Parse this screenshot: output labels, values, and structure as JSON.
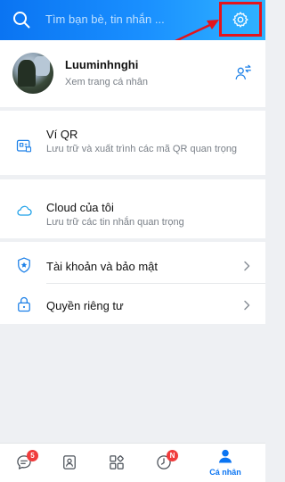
{
  "header": {
    "search_placeholder": "Tìm bạn bè, tin nhắn ..."
  },
  "profile": {
    "name": "Luuminhnghi",
    "subtitle": "Xem trang cá nhân"
  },
  "qr_wallet": {
    "title": "Ví QR",
    "description": "Lưu trữ và xuất trình các mã QR quan trọng"
  },
  "cloud": {
    "title": "Cloud của tôi",
    "description": "Lưu trữ các tin nhắn quan trọng"
  },
  "menu": [
    {
      "label": "Tài khoản và bảo mật",
      "icon": "shield-icon"
    },
    {
      "label": "Quyền riêng tư",
      "icon": "lock-icon"
    }
  ],
  "bottom_nav": {
    "messages_badge": "5",
    "timeline_badge": "N",
    "active_label": "Cá nhân"
  },
  "colors": {
    "accent": "#0a74f2",
    "highlight_box": "#e4141b",
    "badge": "#f03c3c"
  }
}
